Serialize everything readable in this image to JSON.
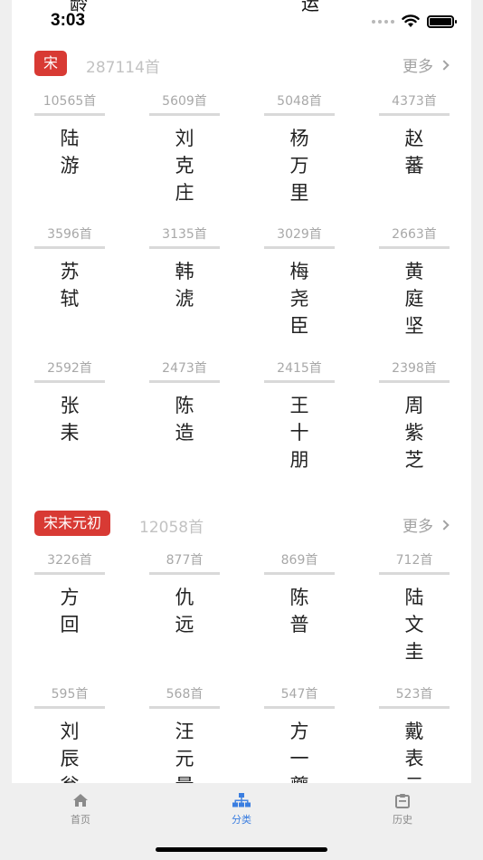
{
  "status": {
    "time": "3:03",
    "peek_left": "龄",
    "peek_right": "运"
  },
  "sections": [
    {
      "dynasty": "宋",
      "count": "287114首",
      "more": "更多",
      "poets": [
        {
          "count": "10565首",
          "name": "陆游"
        },
        {
          "count": "5609首",
          "name": "刘克庄"
        },
        {
          "count": "5048首",
          "name": "杨万里"
        },
        {
          "count": "4373首",
          "name": "赵蕃"
        },
        {
          "count": "3596首",
          "name": "苏轼"
        },
        {
          "count": "3135首",
          "name": "韩淲"
        },
        {
          "count": "3029首",
          "name": "梅尧臣"
        },
        {
          "count": "2663首",
          "name": "黄庭坚"
        },
        {
          "count": "2592首",
          "name": "张耒"
        },
        {
          "count": "2473首",
          "name": "陈造"
        },
        {
          "count": "2415首",
          "name": "王十朋"
        },
        {
          "count": "2398首",
          "name": "周紫芝"
        }
      ]
    },
    {
      "dynasty": "宋末元初",
      "count": "12058首",
      "more": "更多",
      "poets": [
        {
          "count": "3226首",
          "name": "方回"
        },
        {
          "count": "877首",
          "name": "仇远"
        },
        {
          "count": "869首",
          "name": "陈普"
        },
        {
          "count": "712首",
          "name": "陆文圭"
        },
        {
          "count": "595首",
          "name": "刘辰翁"
        },
        {
          "count": "568首",
          "name": "汪元量"
        },
        {
          "count": "547首",
          "name": "方一夔"
        },
        {
          "count": "523首",
          "name": "戴表元"
        }
      ]
    }
  ],
  "tabs": [
    {
      "label": "首页",
      "icon": "home-icon"
    },
    {
      "label": "分类",
      "icon": "category-icon"
    },
    {
      "label": "历史",
      "icon": "history-icon"
    }
  ],
  "colors": {
    "accent": "#d83a34",
    "active_tab": "#3b7ee0"
  }
}
